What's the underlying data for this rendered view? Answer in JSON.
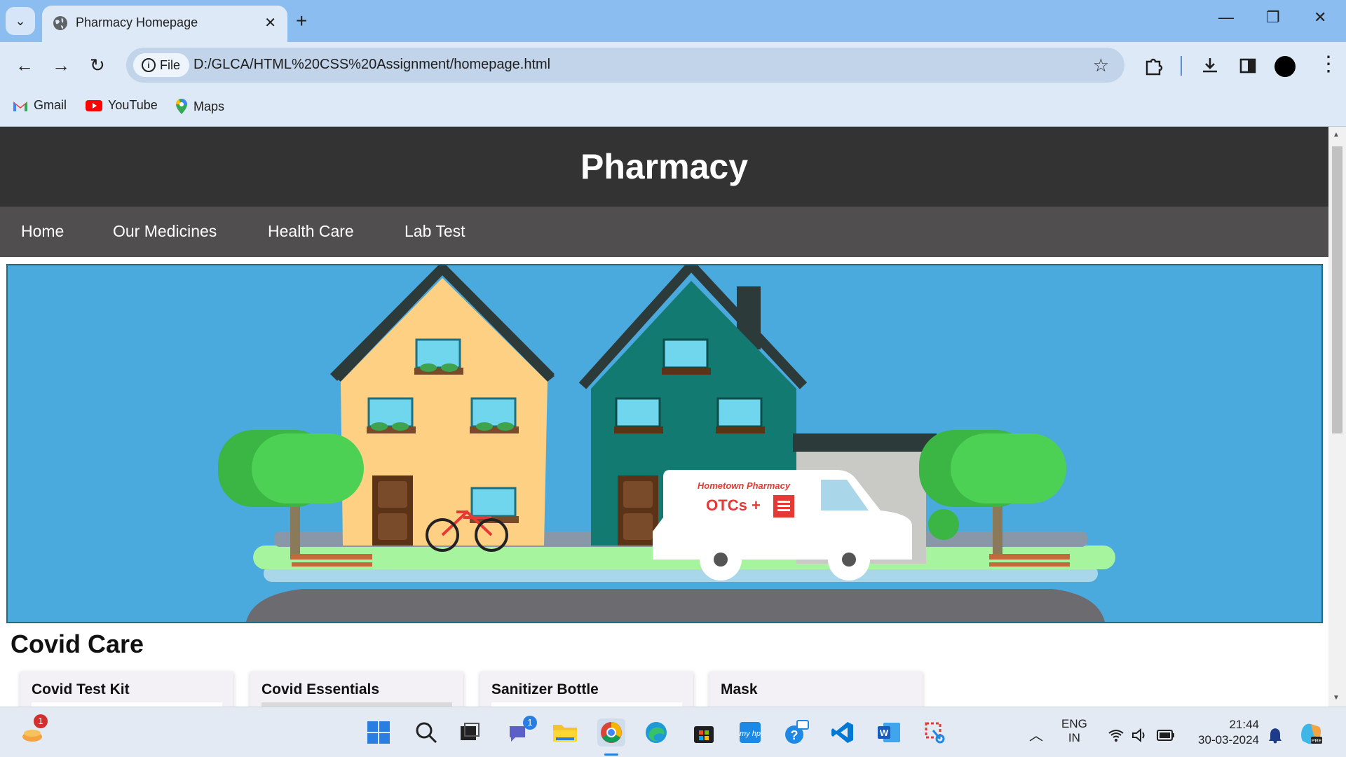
{
  "browser": {
    "tab_title": "Pharmacy Homepage",
    "site_chip": "File",
    "url": "D:/GLCA/HTML%20CSS%20Assignment/homepage.html",
    "bookmarks": [
      "Gmail",
      "YouTube",
      "Maps"
    ]
  },
  "site": {
    "title": "Pharmacy",
    "nav": [
      "Home",
      "Our Medicines",
      "Health Care",
      "Lab Test"
    ],
    "hero": {
      "van_line1": "Hometown Pharmacy",
      "van_line2": "OTCs +"
    },
    "section_title": "Covid Care",
    "cards": [
      "Covid Test Kit",
      "Covid Essentials",
      "Sanitizer Bottle",
      "Mask"
    ]
  },
  "taskbar": {
    "lang_line1": "ENG",
    "lang_line2": "IN",
    "time": "21:44",
    "date": "30-03-2024",
    "badge_weather": "1",
    "badge_teams": "1"
  },
  "colors": {
    "header_bg": "#333333",
    "nav_bg": "#504e4e",
    "hero_sky": "#4aa9dd",
    "house_left": "#fdd083",
    "house_right": "#137a72"
  }
}
